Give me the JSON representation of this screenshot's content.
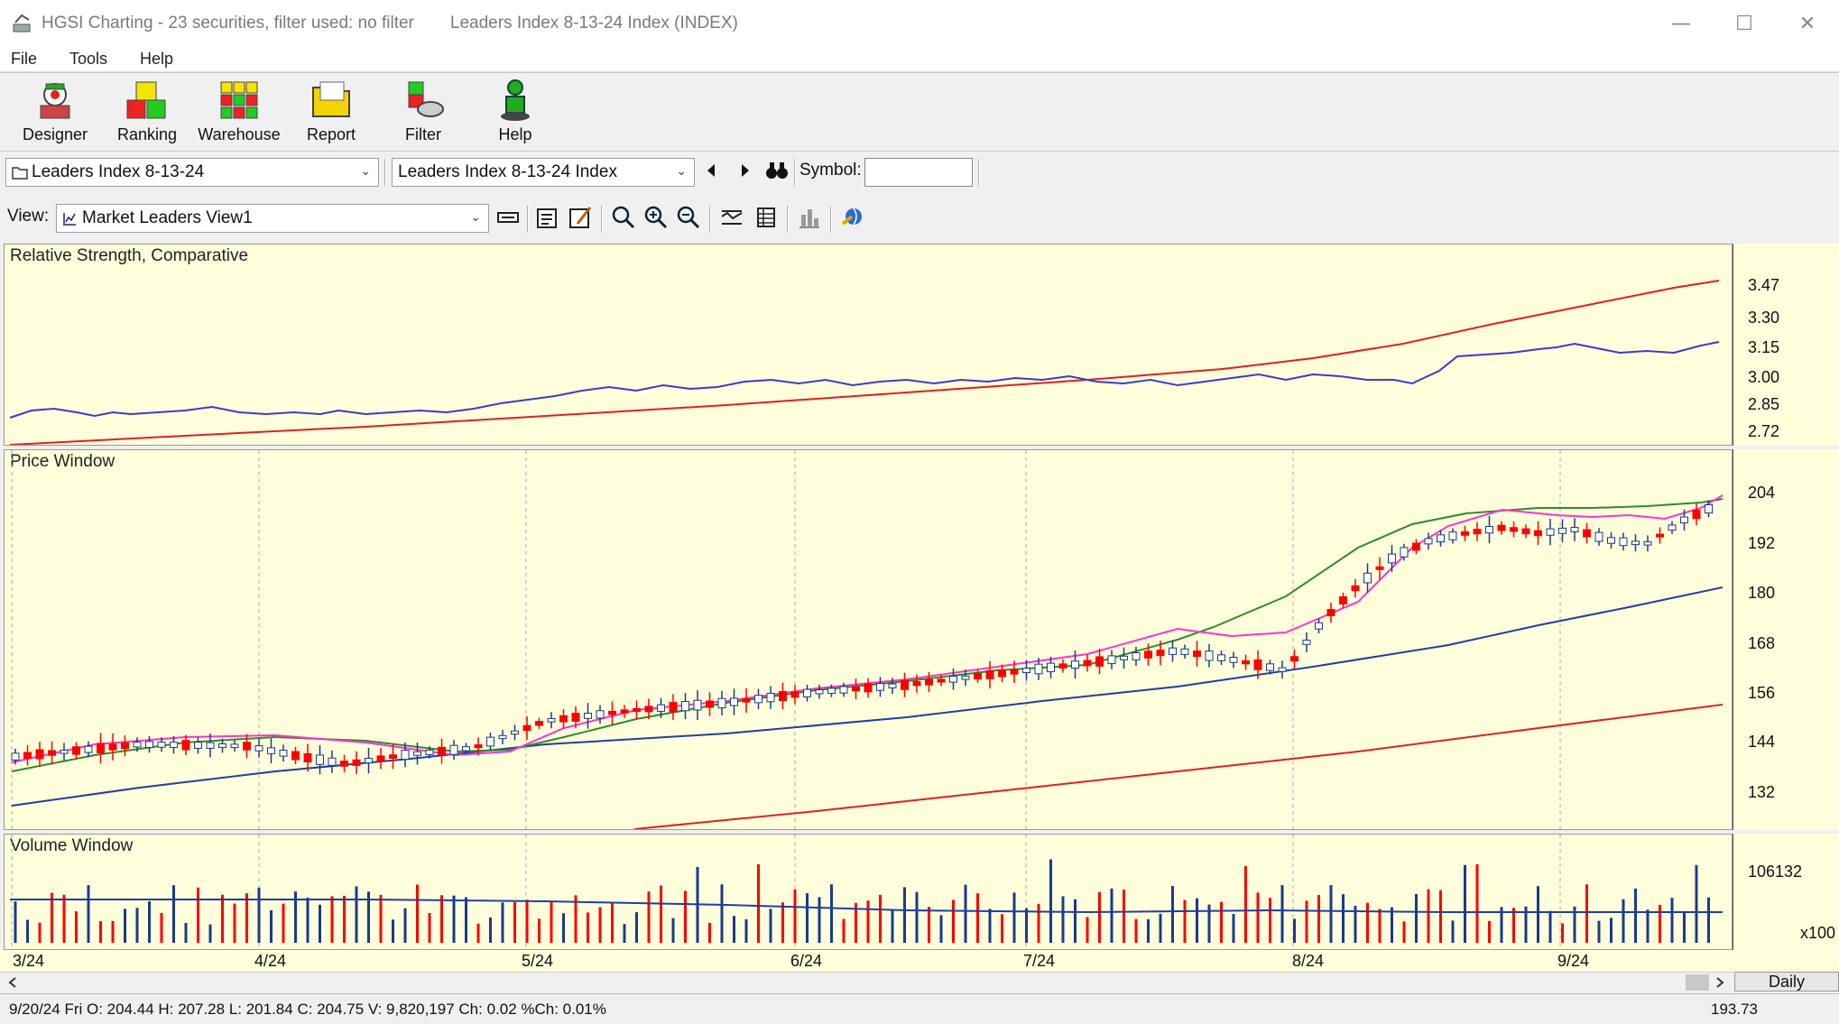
{
  "window": {
    "title": "HGSI Charting - 23 securities, filter used: no filter",
    "subtitle": "Leaders Index 8-13-24 Index (INDEX)",
    "buttons": [
      "—",
      "☐",
      "✕"
    ]
  },
  "menu": [
    "File",
    "Tools",
    "Help"
  ],
  "toolbar": [
    "Designer",
    "Ranking",
    "Warehouse",
    "Report",
    "Filter",
    "Help"
  ],
  "selectors": {
    "list": "Leaders Index 8-13-24",
    "security": "Leaders Index 8-13-24 Index",
    "symbol_label": "Symbol:",
    "symbol_value": ""
  },
  "view": {
    "label": "View:",
    "value": "Market Leaders View1"
  },
  "panels": {
    "rs_title": "Relative Strength, Comparative",
    "price_title": "Price Window",
    "volume_title": "Volume Window"
  },
  "axes": {
    "rs_ticks": [
      "3.47",
      "3.30",
      "3.15",
      "3.00",
      "2.85",
      "2.72"
    ],
    "price_ticks": [
      "204",
      "192",
      "180",
      "168",
      "156",
      "144",
      "132"
    ],
    "volume_ticks": [
      "106132",
      "x100"
    ]
  },
  "dates": [
    "3/24",
    "4/24",
    "5/24",
    "6/24",
    "7/24",
    "8/24",
    "9/24"
  ],
  "period": "Daily",
  "status": {
    "text": "9/20/24 Fri O: 204.44 H: 207.28 L: 201.84 C: 204.75 V: 9,820,197 Ch: 0.02 %Ch: 0.01%",
    "value": "193.73"
  },
  "colors": {
    "background": "#ffffdc",
    "up": "#1a3a8c",
    "down": "#ff0000",
    "rs_line": "#3b3bd0",
    "rs_ma": "#e02020",
    "ma_fast": "#ff33cc",
    "ma_mid": "#2e8b2e",
    "ma_slow": "#1f3f9f",
    "ma_long": "#e02020"
  }
}
